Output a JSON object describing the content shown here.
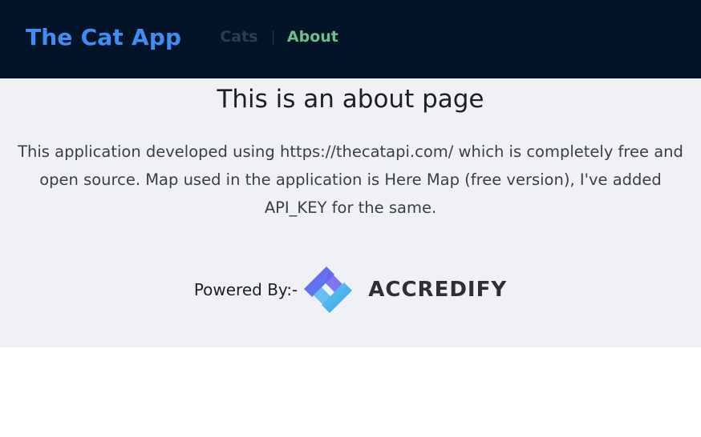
{
  "navbar": {
    "brand": "The Cat App",
    "links": [
      {
        "label": "Cats",
        "active": false
      },
      {
        "label": "About",
        "active": true
      }
    ],
    "separator": "|",
    "colors": {
      "background": "#041428",
      "brand": "#3f8ef5",
      "active": "#6cbf8b",
      "muted": "#2b3d52"
    }
  },
  "main": {
    "title": "This is an about page",
    "description": "This application developed using https://thecatapi.com/ which is completely free and open source. Map used in the application is Here Map (free version), I've added API_KEY for the same.",
    "powered_label": "Powered By:-",
    "logo": {
      "icon": "accredify-logo-icon",
      "text": "ACCREDIFY"
    }
  }
}
